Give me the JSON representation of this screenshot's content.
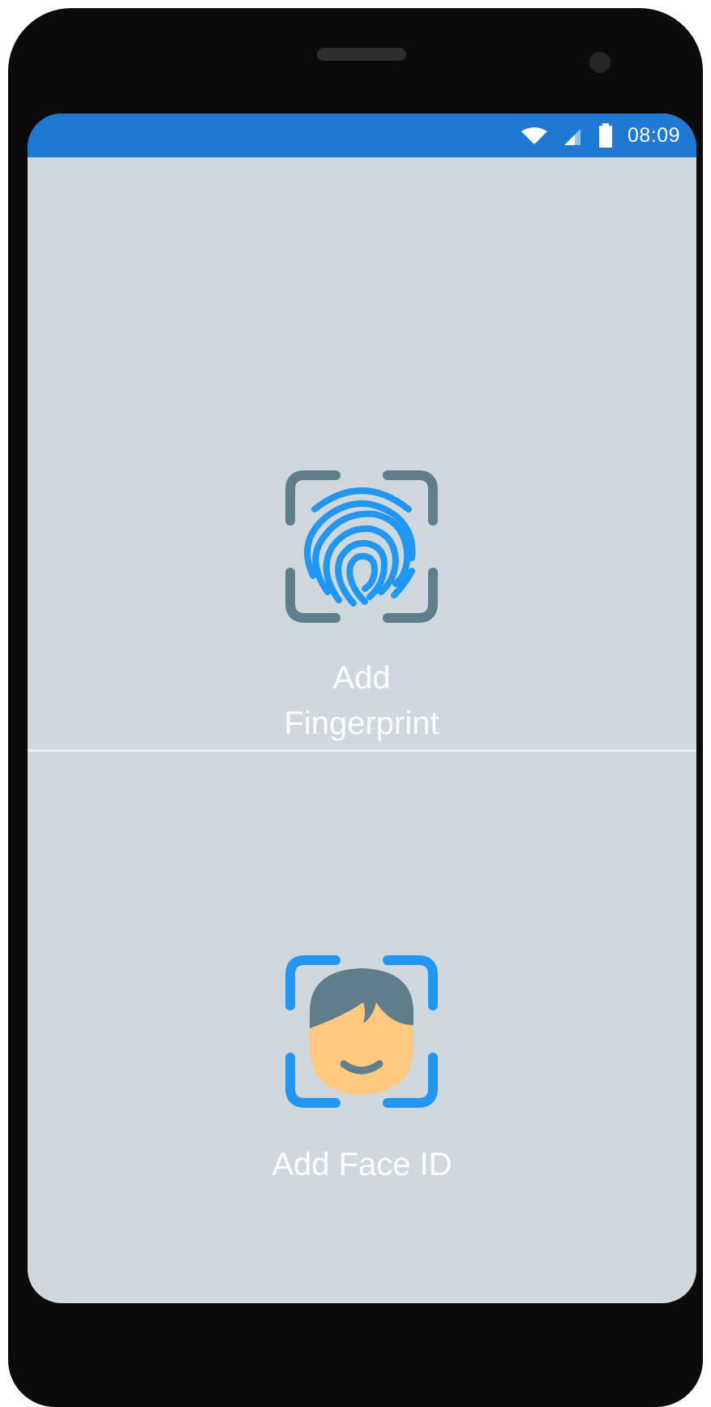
{
  "status_bar": {
    "time": "08:09",
    "icons": [
      "wifi-icon",
      "cellular-signal-icon",
      "battery-icon"
    ],
    "color": "#1f78d1"
  },
  "options": {
    "fingerprint": {
      "label": "Add Fingerprint",
      "icon": "fingerprint-scan-icon"
    },
    "face_id": {
      "label": "Add Face ID",
      "icon": "face-scan-icon"
    }
  },
  "colors": {
    "screen_background": "#cfd8dc",
    "accent_blue": "#2196f3",
    "frame_gray": "#607d8b",
    "skin": "#ffca80",
    "label_text": "#ffffff"
  }
}
